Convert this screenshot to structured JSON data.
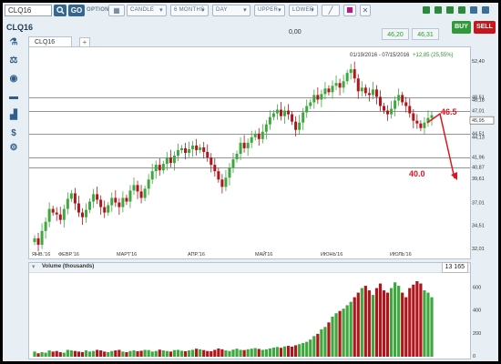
{
  "toolbar": {
    "symbol": "CLQ16",
    "go_label": "GO",
    "option_label": "OPTION",
    "chart_style": "CANDLE",
    "range": "6 MONTHS",
    "interval": "DAY",
    "upper": "UPPER",
    "lower": "LOWER"
  },
  "header": {
    "title": "CLQ16",
    "last": "0,00",
    "bid": "46,20",
    "ask": "46,31",
    "buy": "BUY",
    "sell": "SELL"
  },
  "tab": {
    "label": "CLQ16",
    "add": "+"
  },
  "chart_info": {
    "range_text": "01/19/2016 - 07/15/2016",
    "change_text": "+12,85 (25,55%)"
  },
  "volume": {
    "label": "Volume (thousands)",
    "value": "13 165"
  },
  "annotations": {
    "level_high": "46.5",
    "level_low": "40.0"
  },
  "colors": {
    "up": "#3ea83e",
    "down": "#b0151c",
    "annotation": "#e0141e",
    "accent": "#35668f"
  },
  "icons": [
    "microscope-icon",
    "scale-icon",
    "eye-icon",
    "briefcase-icon",
    "bar-chart-icon",
    "dollar-icon",
    "gear-icon"
  ],
  "chart_data": {
    "type": "candlestick",
    "x_ticks": [
      "ЯНВ.'16",
      "ФЕВР.'16",
      "МАРТ'16",
      "АПР.'16",
      "МАЙ'16",
      "ИЮНЬ'16",
      "ИЮЛЬ'16"
    ],
    "y_ticks": [
      "52,40",
      "48,51",
      "47,01",
      "45,95",
      "44,51",
      "41,96",
      "40,87",
      "37,01",
      "34,51",
      "32,01"
    ],
    "price_labels": [
      {
        "text": "52,40",
        "value": 52.4
      },
      {
        "text": "48,51",
        "value": 48.51
      },
      {
        "text": "48,18",
        "value": 48.18
      },
      {
        "text": "47,01",
        "value": 47.01
      },
      {
        "text": "45,95",
        "value": 45.95,
        "boxed": true
      },
      {
        "text": "44,51",
        "value": 44.51
      },
      {
        "text": "44,13",
        "value": 44.13
      },
      {
        "text": "41,96",
        "value": 41.96
      },
      {
        "text": "40,87",
        "value": 40.87
      },
      {
        "text": "39,61",
        "value": 39.61
      },
      {
        "text": "37,01",
        "value": 37.01
      },
      {
        "text": "34,51",
        "value": 34.51
      },
      {
        "text": "32,01",
        "value": 32.01
      }
    ],
    "horizontal_levels": [
      48.51,
      47.01,
      44.51,
      41.96,
      40.87
    ],
    "ylim": [
      32.0,
      52.8
    ],
    "closes": [
      33.2,
      32.5,
      34.0,
      35.0,
      36.4,
      36.0,
      35.8,
      35.2,
      36.4,
      37.5,
      38.1,
      37.0,
      36.0,
      35.5,
      36.3,
      37.2,
      38.0,
      37.4,
      36.6,
      36.0,
      36.8,
      37.6,
      37.1,
      36.6,
      37.6,
      37.2,
      38.4,
      39.0,
      38.3,
      37.6,
      38.6,
      39.6,
      40.5,
      41.2,
      40.6,
      41.3,
      42.0,
      41.4,
      42.2,
      42.8,
      43.0,
      42.5,
      42.9,
      43.3,
      42.8,
      43.1,
      42.6,
      42.0,
      41.2,
      40.5,
      39.6,
      38.8,
      39.8,
      40.9,
      41.8,
      42.4,
      43.6,
      43.0,
      43.6,
      44.2,
      44.6,
      44.0,
      44.8,
      45.6,
      46.4,
      46.8,
      47.2,
      46.5,
      47.1,
      46.7,
      45.9,
      45.0,
      45.8,
      46.9,
      47.6,
      48.0,
      48.8,
      48.3,
      48.9,
      49.5,
      49.1,
      49.8,
      50.1,
      49.6,
      50.3,
      51.2,
      51.6,
      50.6,
      49.2,
      49.6,
      49.0,
      48.8,
      49.4,
      48.6,
      47.6,
      47.1,
      46.7,
      47.3,
      48.2,
      48.8,
      48.0,
      47.6,
      46.8,
      46.0,
      45.7,
      45.2,
      45.8,
      46.3,
      46.6
    ],
    "volume_ylim": [
      0,
      700
    ],
    "volume_ticks": [
      "600",
      "400",
      "200",
      "0"
    ],
    "volumes": [
      45,
      30,
      40,
      35,
      55,
      45,
      50,
      40,
      35,
      60,
      55,
      50,
      45,
      40,
      55,
      45,
      50,
      60,
      55,
      45,
      40,
      50,
      55,
      60,
      45,
      40,
      50,
      55,
      48,
      52,
      60,
      58,
      45,
      50,
      62,
      55,
      50,
      45,
      58,
      60,
      52,
      48,
      55,
      60,
      70,
      65,
      58,
      50,
      48,
      60,
      72,
      65,
      55,
      50,
      62,
      70,
      60,
      58,
      65,
      70,
      75,
      68,
      60,
      65,
      72,
      80,
      85,
      78,
      90,
      95,
      88,
      100,
      110,
      120,
      130,
      150,
      180,
      200,
      240,
      260,
      300,
      350,
      380,
      400,
      420,
      450,
      480,
      520,
      560,
      600,
      620,
      580,
      540,
      600,
      640,
      580,
      560,
      600,
      650,
      620,
      560,
      520,
      600,
      630,
      660,
      640,
      580,
      560,
      520
    ]
  }
}
